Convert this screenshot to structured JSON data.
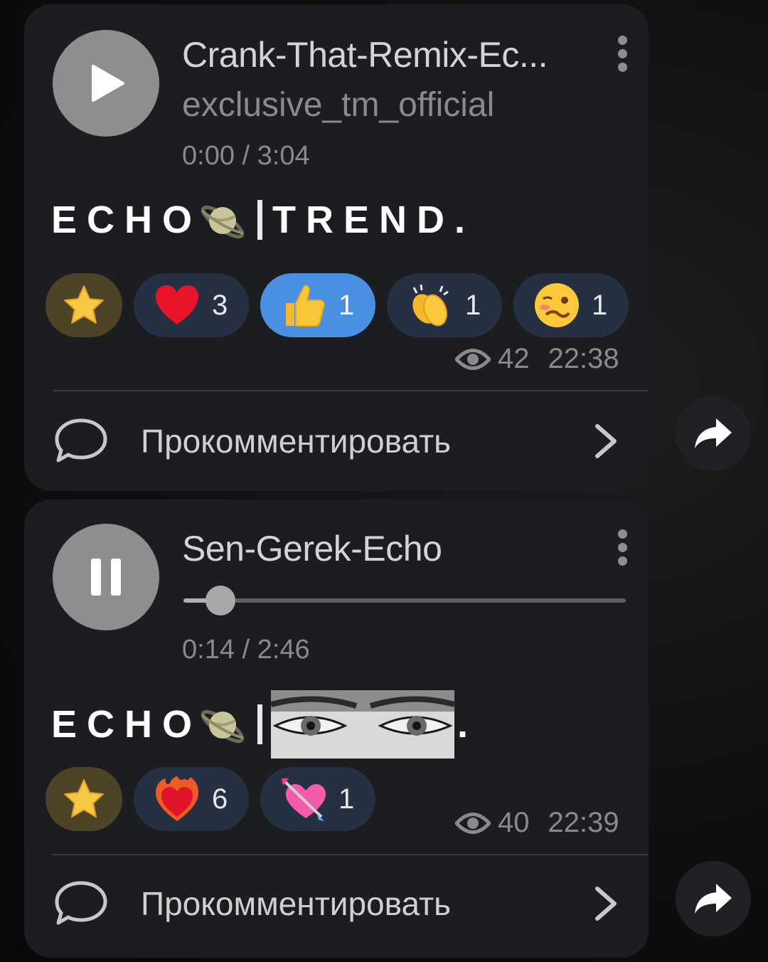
{
  "posts": [
    {
      "track_title": "Crank-That-Remix-Ec...",
      "track_artist": "exclusive_tm_official",
      "track_time": "0:00 / 3:04",
      "caption_left": "ECHO",
      "caption_right": "TREND.",
      "reactions": [
        {
          "icon": "star-icon",
          "count": ""
        },
        {
          "icon": "red-heart-icon",
          "count": "3"
        },
        {
          "icon": "thumbs-up-icon",
          "count": "1",
          "selected": true
        },
        {
          "icon": "clapping-hands-icon",
          "count": "1"
        },
        {
          "icon": "woozy-face-icon",
          "count": "1"
        }
      ],
      "views": "42",
      "post_time": "22:38",
      "comment_label": "Прокомментировать"
    },
    {
      "track_title": "Sen-Gerek-Echo",
      "track_time": "0:14 / 2:46",
      "playback_progress": 0.084,
      "caption_left": "ECHO",
      "caption_right": ".",
      "reactions": [
        {
          "icon": "star-icon",
          "count": ""
        },
        {
          "icon": "heart-on-fire-icon",
          "count": "6"
        },
        {
          "icon": "heart-with-arrow-icon",
          "count": "1"
        }
      ],
      "views": "40",
      "post_time": "22:39",
      "comment_label": "Прокомментировать"
    }
  ],
  "colors": {
    "card_bg": "#1c1d21",
    "reaction_bg": "#263043",
    "reaction_selected_bg": "#4a90e2",
    "star_reaction_bg": "#4d4326",
    "muted_text": "#8a8a8c"
  }
}
